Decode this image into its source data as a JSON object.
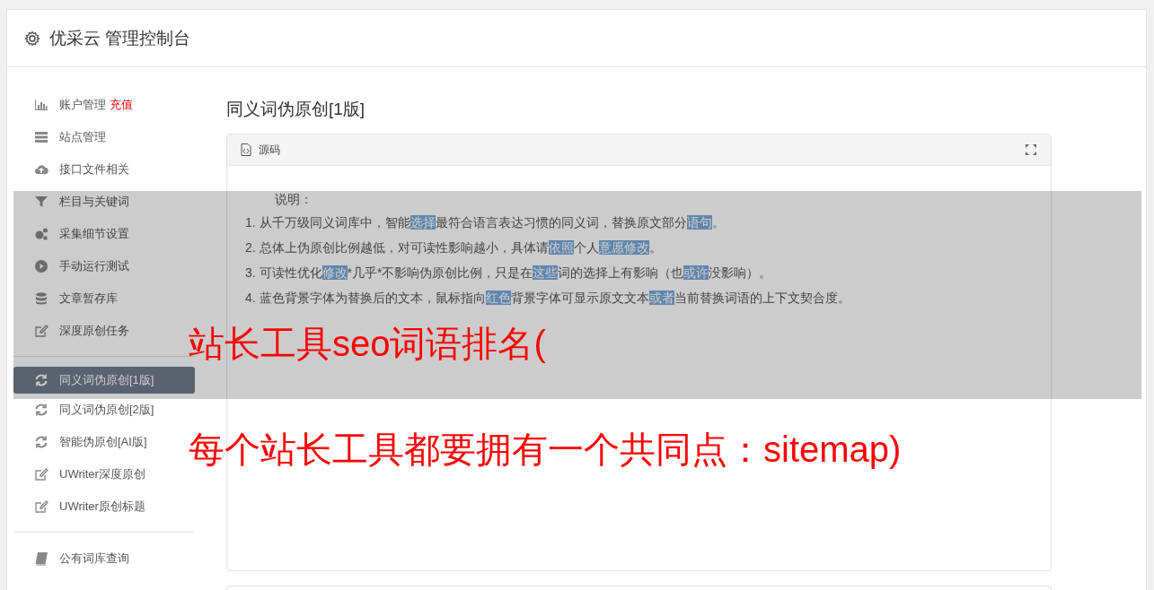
{
  "header": {
    "title": "优采云 管理控制台"
  },
  "sidebar": {
    "groups": [
      [
        {
          "kind": "chart",
          "label": "账户管理",
          "badge": "充值",
          "selected": false
        },
        {
          "kind": "server",
          "label": "站点管理",
          "selected": false
        },
        {
          "kind": "cloud",
          "label": "接口文件相关",
          "selected": false
        },
        {
          "kind": "filter",
          "label": "栏目与关键词",
          "selected": false
        },
        {
          "kind": "gears",
          "label": "采集细节设置",
          "selected": false
        },
        {
          "kind": "play",
          "label": "手动运行测试",
          "selected": false
        },
        {
          "kind": "database",
          "label": "文章暂存库",
          "selected": false
        },
        {
          "kind": "edit",
          "label": "深度原创任务",
          "selected": false
        }
      ],
      [
        {
          "kind": "refresh",
          "label": "同义词伪原创[1版]",
          "selected": true
        },
        {
          "kind": "refresh",
          "label": "同义词伪原创[2版]",
          "selected": false
        },
        {
          "kind": "refresh",
          "label": "智能伪原创[AI版]",
          "selected": false
        },
        {
          "kind": "edit",
          "label": "UWriter深度原创",
          "selected": false
        },
        {
          "kind": "edit",
          "label": "UWriter原创标题",
          "selected": false
        }
      ],
      [
        {
          "kind": "book",
          "label": "公有词库查询",
          "selected": false
        }
      ]
    ]
  },
  "main": {
    "title": "同义词伪原创[1版]",
    "panel": {
      "title": "源码",
      "intro": "说明：",
      "lines": [
        [
          {
            "text": "1. 从千万级同义词库中，智能",
            "highlighted": false
          },
          {
            "text": "选择",
            "highlighted": true
          },
          {
            "text": "最符合语言表达习惯的同义词，替换原文部分",
            "highlighted": false
          },
          {
            "text": "语句",
            "highlighted": true
          },
          {
            "text": "。",
            "highlighted": false
          }
        ],
        [
          {
            "text": "2. 总体上伪原创比例越低，对可读性影响越小，具体请",
            "highlighted": false
          },
          {
            "text": "依照",
            "highlighted": true
          },
          {
            "text": "个人",
            "highlighted": false
          },
          {
            "text": "意愿",
            "highlighted": true
          },
          {
            "text": "修改",
            "highlighted": true
          },
          {
            "text": "。",
            "highlighted": false
          }
        ],
        [
          {
            "text": "3. 可读性优化",
            "highlighted": false
          },
          {
            "text": "修改",
            "highlighted": true
          },
          {
            "text": "*几乎*不影响伪原创比例，只是在",
            "highlighted": false
          },
          {
            "text": "这些",
            "highlighted": true
          },
          {
            "text": "词的选择上有影响（也",
            "highlighted": false
          },
          {
            "text": "或许",
            "highlighted": true
          },
          {
            "text": "没影响）。",
            "highlighted": false
          }
        ],
        [
          {
            "text": "4. 蓝色背景字体为替换后的文本，鼠标指向",
            "highlighted": false
          },
          {
            "text": "红色",
            "highlighted": true
          },
          {
            "text": "背景字体可显示原文文本",
            "highlighted": false
          },
          {
            "text": "或者",
            "highlighted": true
          },
          {
            "text": "当前替换词语的上下文契合度。",
            "highlighted": false
          }
        ]
      ]
    }
  },
  "overlay": {
    "lines": [
      "站长工具seo词语排名(",
      "每个站长工具都要拥有一个共同点：sitemap)"
    ]
  }
}
